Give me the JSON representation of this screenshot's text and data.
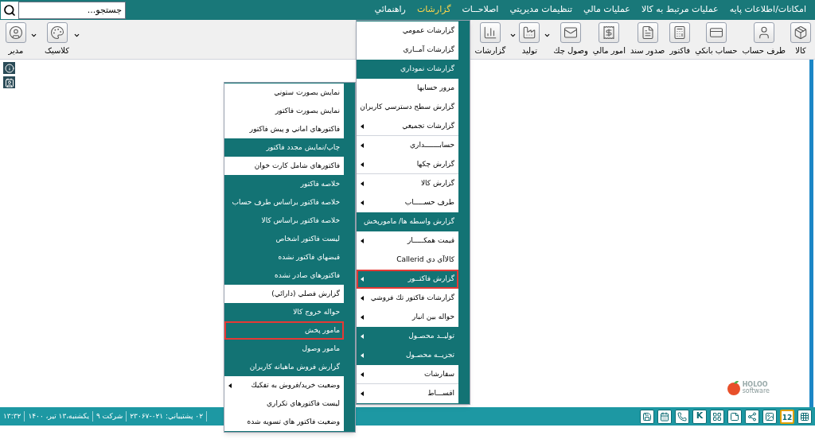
{
  "search": {
    "placeholder": "جستجو..."
  },
  "menubar": [
    {
      "label": "امکانات/اطلاعات پایه",
      "selected": false
    },
    {
      "label": "عملیات مرتبط به کالا",
      "selected": false
    },
    {
      "label": "عملیات مالي",
      "selected": false
    },
    {
      "label": "تنظیمات مدیریتي",
      "selected": false
    },
    {
      "label": "اصلاحــات",
      "selected": false
    },
    {
      "label": "گزارشات",
      "selected": true
    },
    {
      "label": "راهنمائي",
      "selected": false
    }
  ],
  "toolbar": {
    "main": [
      {
        "label": "کالا",
        "dropdown": false
      },
      {
        "label": "طرف حساب",
        "dropdown": false
      },
      {
        "label": "حساب بانکي",
        "dropdown": false
      },
      {
        "label": "فاکتور",
        "dropdown": false
      },
      {
        "label": "صدور سند",
        "dropdown": false
      },
      {
        "label": "امور مالي",
        "dropdown": false
      },
      {
        "label": "وصول چك",
        "dropdown": false
      },
      {
        "label": "تولید",
        "dropdown": true
      },
      {
        "label": "گزارشات",
        "dropdown": true
      }
    ],
    "user": [
      {
        "label": "کلاسیک",
        "dropdown": true
      },
      {
        "label": "مدیر",
        "dropdown": true
      }
    ]
  },
  "reports_menu": {
    "items": [
      {
        "label": "گزارشات عمومي",
        "kind": "light",
        "submenu": false,
        "selected": false,
        "separator_after": false
      },
      {
        "label": "گزارشات آمــاري",
        "kind": "light",
        "submenu": false,
        "selected": false,
        "separator_after": false
      },
      {
        "label": "گزارشات نموداري",
        "kind": "dark",
        "submenu": false,
        "selected": false,
        "separator_after": false
      },
      {
        "label": "مرور حسابها",
        "kind": "light",
        "submenu": false,
        "selected": false,
        "separator_after": false
      },
      {
        "label": "گزارش سطح دسترسي کاربران",
        "kind": "light",
        "submenu": false,
        "selected": false,
        "separator_after": false
      },
      {
        "label": "گزارشات تجمیعي",
        "kind": "light",
        "submenu": true,
        "selected": false,
        "separator_after": true
      },
      {
        "label": "حسابـــــــداري",
        "kind": "light",
        "submenu": true,
        "selected": false,
        "separator_after": false
      },
      {
        "label": "گزارش چکها",
        "kind": "light",
        "submenu": true,
        "selected": false,
        "separator_after": true
      },
      {
        "label": "گزارش کالا",
        "kind": "light",
        "submenu": true,
        "selected": false,
        "separator_after": false
      },
      {
        "label": "طرف حســـــاب",
        "kind": "light",
        "submenu": true,
        "selected": false,
        "separator_after": false
      },
      {
        "label": "گزارش واسطه ها/ مامورپخش",
        "kind": "dark",
        "submenu": false,
        "selected": false,
        "separator_after": false
      },
      {
        "label": "قیمت همکـــــار",
        "kind": "light",
        "submenu": true,
        "selected": false,
        "separator_after": false
      },
      {
        "label": "کالاآي دي Callerid",
        "kind": "light",
        "submenu": false,
        "selected": false,
        "separator_after": false
      },
      {
        "label": "گزارش فاکتــور",
        "kind": "dark",
        "submenu": true,
        "selected": true,
        "separator_after": false
      },
      {
        "label": "گزارشات فاکتور تك فروشي",
        "kind": "light",
        "submenu": true,
        "selected": false,
        "separator_after": false
      },
      {
        "label": "حواله بین انبار",
        "kind": "light",
        "submenu": true,
        "selected": false,
        "separator_after": false
      },
      {
        "label": "تولیــد محصـول",
        "kind": "dark",
        "submenu": true,
        "selected": false,
        "separator_after": false
      },
      {
        "label": "تجزیــه محصـول",
        "kind": "dark",
        "submenu": true,
        "selected": false,
        "separator_after": false
      },
      {
        "label": "سفارشات",
        "kind": "light",
        "submenu": true,
        "selected": false,
        "separator_after": true
      },
      {
        "label": "اقســـاط",
        "kind": "light",
        "submenu": true,
        "selected": false,
        "separator_after": false
      }
    ]
  },
  "invoice_submenu": {
    "items": [
      {
        "label": "نمایش بصورت ستوني",
        "kind": "light",
        "submenu": false,
        "selected": false,
        "separator_after": false
      },
      {
        "label": "نمایش بصورت فاکتور",
        "kind": "light",
        "submenu": false,
        "selected": false,
        "separator_after": false
      },
      {
        "label": "فاکتورهاي اماني و پیش فاکتور",
        "kind": "light",
        "submenu": false,
        "selected": false,
        "separator_after": false
      },
      {
        "label": "چاپ/نمایش مجدد فاکتور",
        "kind": "dark",
        "submenu": false,
        "selected": false,
        "separator_after": false
      },
      {
        "label": "فاکتورهاي شامل کارت خوان",
        "kind": "light",
        "submenu": false,
        "selected": false,
        "separator_after": false
      },
      {
        "label": "خلاصه فاکتور",
        "kind": "dark",
        "submenu": false,
        "selected": false,
        "separator_after": false
      },
      {
        "label": "خلاصه فاکتور براساس طرف حساب",
        "kind": "dark",
        "submenu": false,
        "selected": false,
        "separator_after": false
      },
      {
        "label": "خلاصه فاکتور براساس کالا",
        "kind": "dark",
        "submenu": false,
        "selected": false,
        "separator_after": false
      },
      {
        "label": "لیست فاکتور اشخاص",
        "kind": "dark",
        "submenu": false,
        "selected": false,
        "separator_after": false
      },
      {
        "label": "قبضهاي فاکتور نشده",
        "kind": "dark",
        "submenu": false,
        "selected": false,
        "separator_after": false
      },
      {
        "label": "فاکتورهاي صادر نشده",
        "kind": "dark",
        "submenu": false,
        "selected": false,
        "separator_after": false
      },
      {
        "label": "گزارش فصلي (دارائي)",
        "kind": "light",
        "submenu": false,
        "selected": false,
        "separator_after": false
      },
      {
        "label": "حواله خروج کالا",
        "kind": "dark",
        "submenu": false,
        "selected": false,
        "separator_after": false
      },
      {
        "label": "مامور پخش",
        "kind": "dark",
        "submenu": false,
        "selected": true,
        "separator_after": false
      },
      {
        "label": "مامور وصول",
        "kind": "dark",
        "submenu": false,
        "selected": false,
        "separator_after": false
      },
      {
        "label": "گزارش فروش ماهیانه کاربران",
        "kind": "dark",
        "submenu": false,
        "selected": false,
        "separator_after": false
      },
      {
        "label": "وضعیت خرید/فروش به تفکیك",
        "kind": "light",
        "submenu": true,
        "selected": false,
        "separator_after": false
      },
      {
        "label": "لیست فاکتورهاي تکراري",
        "kind": "light",
        "submenu": false,
        "selected": false,
        "separator_after": false
      },
      {
        "label": "وضعیت فاکتور هاي تسویه شده",
        "kind": "light",
        "submenu": false,
        "selected": false,
        "separator_after": false
      }
    ]
  },
  "logo": {
    "name": "HOLOO",
    "tagline": "software"
  },
  "status_bar": {
    "texts": [
      "۱۳:۳۲",
      "یکشنبه،۱۳ تیر، ۱۴۰۰",
      "شرکت ۹",
      "۰۲ پشتیباني: ۰۲۱-۲۳۰۶۷"
    ],
    "key_label": "K",
    "calendar_day": "12"
  }
}
